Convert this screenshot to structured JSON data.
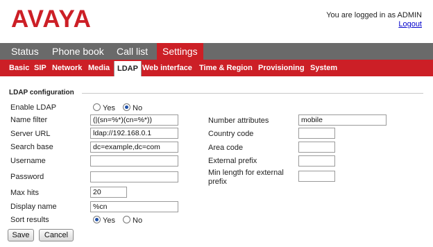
{
  "header": {
    "logo": "AVAYA",
    "login_text": "You are logged in as ADMIN",
    "logout_link": "Logout"
  },
  "main_nav": {
    "tabs": [
      {
        "label": "Status"
      },
      {
        "label": "Phone book"
      },
      {
        "label": "Call list"
      },
      {
        "label": "Settings",
        "active": true
      }
    ]
  },
  "sub_nav": {
    "items": [
      {
        "label": "Basic"
      },
      {
        "label": "SIP"
      },
      {
        "label": "Network"
      },
      {
        "label": "Media"
      },
      {
        "label": "LDAP",
        "active": true
      },
      {
        "label": "Web interface"
      },
      {
        "label": "Time & Region"
      },
      {
        "label": "Provisioning"
      },
      {
        "label": "System"
      }
    ]
  },
  "form": {
    "section_title": "LDAP configuration",
    "enable_ldap": {
      "label": "Enable LDAP",
      "yes": "Yes",
      "no": "No",
      "selected": "No"
    },
    "name_filter": {
      "label": "Name filter",
      "value": "(|(sn=%*)(cn=%*))"
    },
    "server_url": {
      "label": "Server URL",
      "value": "ldap://192.168.0.1"
    },
    "search_base": {
      "label": "Search base",
      "value": "dc=example,dc=com"
    },
    "username": {
      "label": "Username",
      "value": ""
    },
    "password": {
      "label": "Password",
      "value": ""
    },
    "max_hits": {
      "label": "Max hits",
      "value": "20"
    },
    "display_name": {
      "label": "Display name",
      "value": "%cn"
    },
    "sort_results": {
      "label": "Sort results",
      "yes": "Yes",
      "no": "No",
      "selected": "Yes"
    },
    "number_attributes": {
      "label": "Number attributes",
      "value": "mobile"
    },
    "country_code": {
      "label": "Country code",
      "value": ""
    },
    "area_code": {
      "label": "Area code",
      "value": ""
    },
    "external_prefix": {
      "label": "External prefix",
      "value": ""
    },
    "min_length": {
      "label_line1": "Min length for external",
      "label_line2": "prefix",
      "value": ""
    }
  },
  "buttons": {
    "save": "Save",
    "cancel": "Cancel"
  },
  "colors": {
    "brand_red": "#cc1f26",
    "nav_gray": "#6a6a6a",
    "link_blue": "#0000cc"
  }
}
